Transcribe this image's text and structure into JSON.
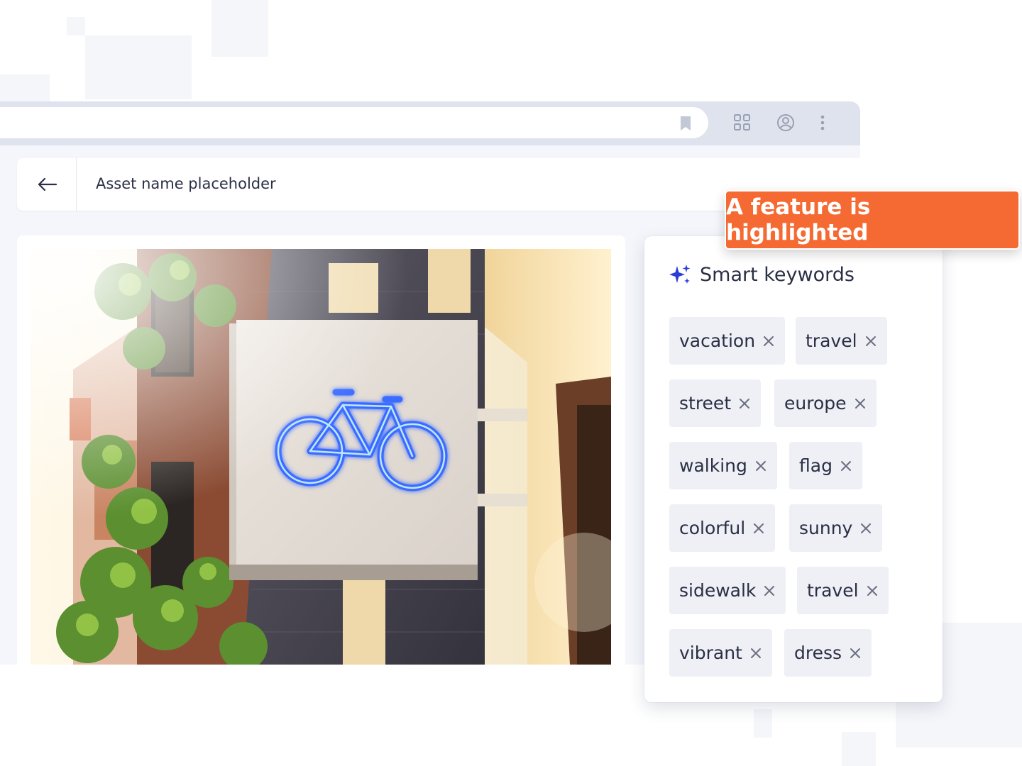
{
  "header": {
    "title": "Asset name placeholder"
  },
  "callout": {
    "text": "A feature is highlighted"
  },
  "keywords_panel": {
    "title": "Smart keywords",
    "keywords": [
      "vacation",
      "travel",
      "street",
      "europe",
      "walking",
      "flag",
      "colorful",
      "sunny",
      "sidewalk",
      "travel",
      "vibrant",
      "dress"
    ]
  },
  "colors": {
    "accent": "#f56a32",
    "chip_bg": "#eef0f5",
    "sparkle": "#2b3dd6",
    "neon": "#3b6cff"
  },
  "icons": [
    "bookmark-icon",
    "apps-grid-icon",
    "account-icon",
    "more-vert-icon",
    "arrow-left-icon",
    "sparkle-icon",
    "close-icon"
  ]
}
